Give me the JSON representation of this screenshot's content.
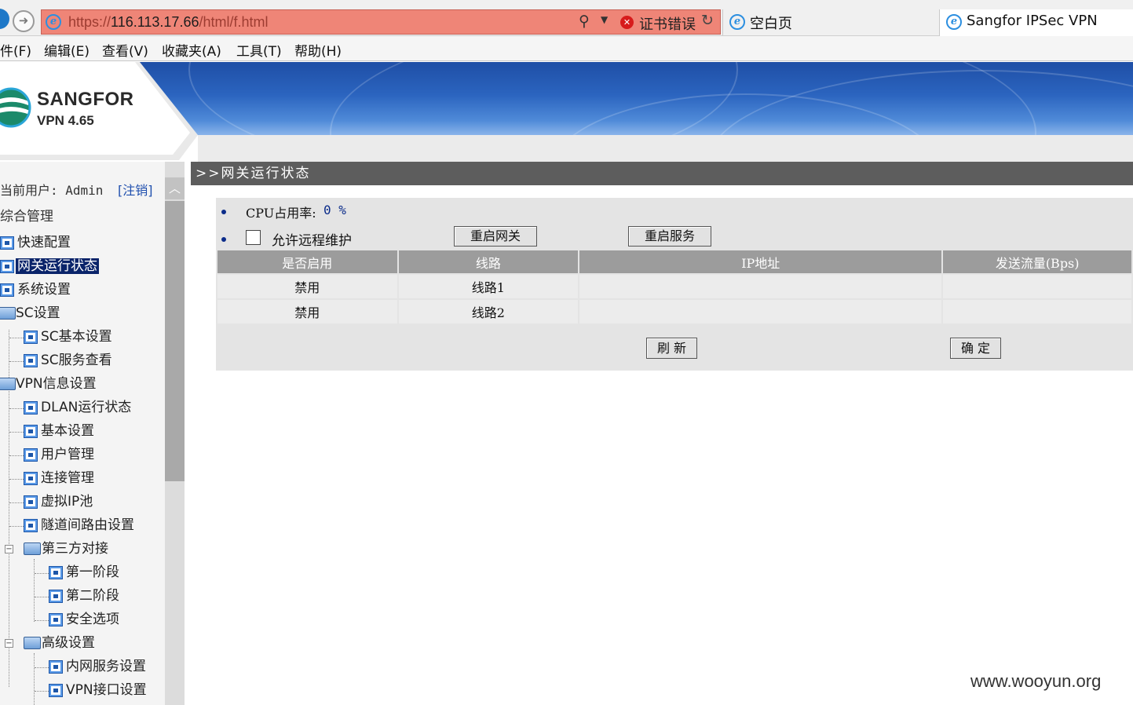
{
  "browser": {
    "address": {
      "scheme": "https://",
      "host": "116.113.17.66",
      "path": "/html/f.html",
      "cert_error": "证书错误"
    },
    "tabs": [
      {
        "label": "空白页"
      },
      {
        "label": "Sangfor IPSec VPN"
      }
    ],
    "menu": [
      "件(F)",
      "编辑(E)",
      "查看(V)",
      "收藏夹(A)",
      "工具(T)",
      "帮助(H)"
    ]
  },
  "header": {
    "brand": "SANGFOR",
    "version": "VPN 4.65"
  },
  "sidebar": {
    "current_user": "当前用户: Admin",
    "logout": "[注销]",
    "group_title": "综合管理",
    "items": [
      {
        "label": "快速配置"
      },
      {
        "label": "网关运行状态"
      },
      {
        "label": "系统设置"
      },
      {
        "label": "SC设置"
      },
      {
        "label": "SC基本设置"
      },
      {
        "label": "SC服务查看"
      },
      {
        "label": "VPN信息设置"
      },
      {
        "label": "DLAN运行状态"
      },
      {
        "label": "基本设置"
      },
      {
        "label": "用户管理"
      },
      {
        "label": "连接管理"
      },
      {
        "label": "虚拟IP池"
      },
      {
        "label": "隧道间路由设置"
      },
      {
        "label": "第三方对接"
      },
      {
        "label": "第一阶段"
      },
      {
        "label": "第二阶段"
      },
      {
        "label": "安全选项"
      },
      {
        "label": "高级设置"
      },
      {
        "label": "内网服务设置"
      },
      {
        "label": "VPN接口设置"
      }
    ]
  },
  "main": {
    "title": ">>网关运行状态",
    "cpu_label": "CPU占用率:",
    "cpu_value": "0 %",
    "remote_label": "允许远程维护",
    "restart_gateway": "重启网关",
    "restart_service": "重启服务",
    "table": {
      "headers": [
        "是否启用",
        "线路",
        "IP地址",
        "发送流量(Bps)"
      ],
      "rows": [
        [
          "禁用",
          "线路1",
          "",
          ""
        ],
        [
          "禁用",
          "线路2",
          "",
          ""
        ]
      ]
    },
    "refresh": "刷 新",
    "confirm": "确 定"
  },
  "watermark": "www.wooyun.org"
}
